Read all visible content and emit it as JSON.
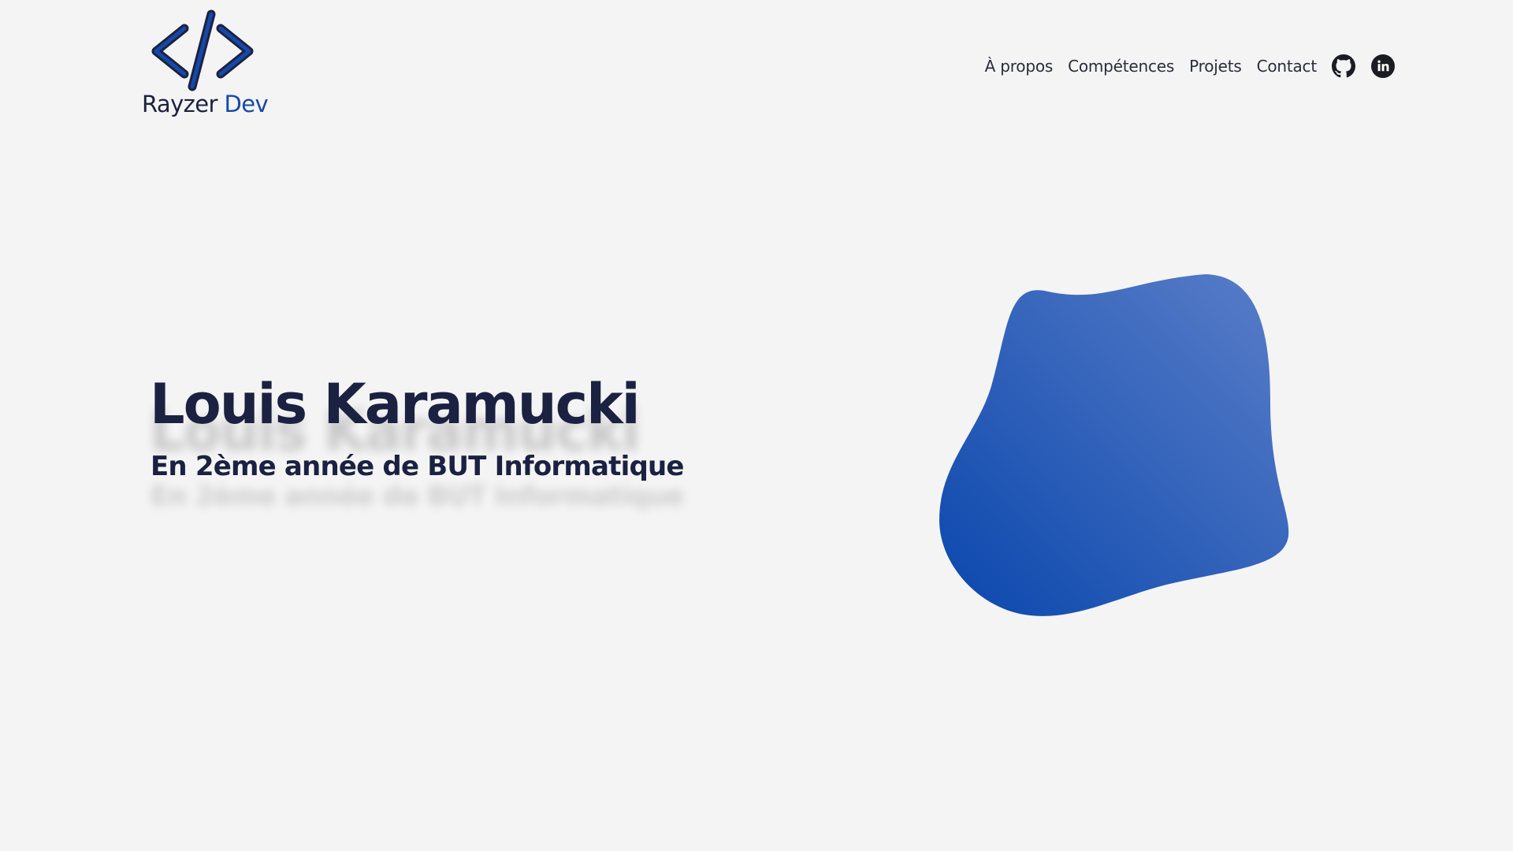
{
  "header": {
    "logo": {
      "name_main": "Rayzer",
      "name_accent": "Dev",
      "icon": "code-brackets-icon"
    },
    "nav": {
      "items": [
        {
          "label": "À propos"
        },
        {
          "label": "Compétences"
        },
        {
          "label": "Projets"
        },
        {
          "label": "Contact"
        }
      ],
      "github_icon": "github-icon",
      "linkedin_icon": "linkedin-icon"
    }
  },
  "hero": {
    "name": "Louis Karamucki",
    "subtitle": "En 2ème année de BUT Informatique"
  },
  "colors": {
    "background": "#f4f4f4",
    "text_dark": "#1a2141",
    "accent_blue": "#1549a8",
    "blob_gradient_start": "#0a47ad",
    "blob_gradient_end": "#5a7ec8"
  }
}
